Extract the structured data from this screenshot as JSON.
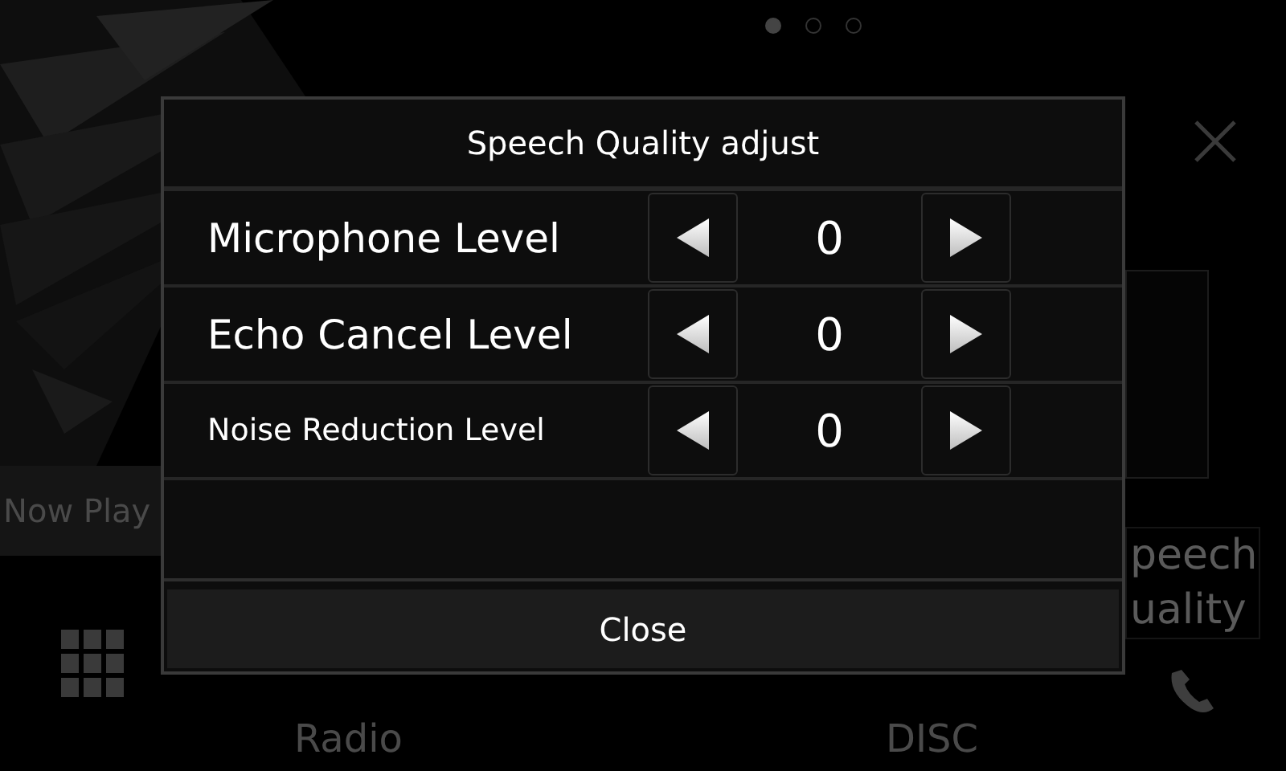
{
  "background": {
    "page_dots": [
      {
        "selected": true
      },
      {
        "selected": false
      },
      {
        "selected": false
      }
    ],
    "now_playing": "Now Play",
    "sources": [
      "Radio",
      "DISC"
    ],
    "speech_tile": [
      "peech",
      "uality"
    ]
  },
  "dialog": {
    "title": "Speech Quality adjust",
    "rows": [
      {
        "label": "Microphone Level",
        "value": "0",
        "kind": "large"
      },
      {
        "label": "Echo Cancel Level",
        "value": "0",
        "kind": "large"
      },
      {
        "label": "Noise Reduction Level",
        "value": "0",
        "kind": "compact"
      }
    ],
    "close": "Close"
  }
}
